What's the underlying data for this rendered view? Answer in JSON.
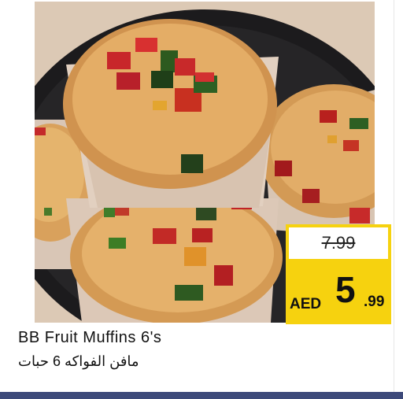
{
  "product": {
    "name_en": "BB Fruit Muffins 6's",
    "name_ar": "مافن الفواكه 6 حبات",
    "image_description_icon": "muffin-photo"
  },
  "price": {
    "old": "7.99",
    "currency": "AED",
    "main": "5",
    "decimals": ".99"
  },
  "colors": {
    "price_box": "#f6d20f",
    "bottom_bar": "#3d4a7a"
  }
}
